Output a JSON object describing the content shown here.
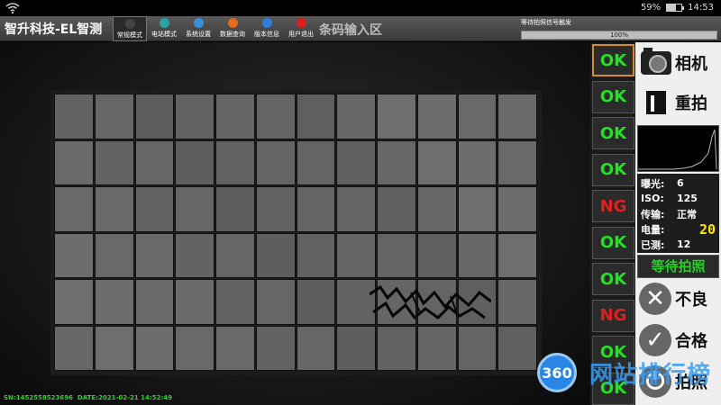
{
  "statusbar": {
    "battery": "59%",
    "battery_level": 0.59,
    "time": "14:53"
  },
  "header": {
    "title": "智升科技-EL智测",
    "toolbar": [
      {
        "label": "常规模式",
        "icon": "camera-mode-icon",
        "color": "#444444",
        "active": true
      },
      {
        "label": "电站模式",
        "icon": "station-mode-icon",
        "color": "#2aa3a3",
        "active": false
      },
      {
        "label": "系统设置",
        "icon": "gear-icon",
        "color": "#3a8fd8",
        "active": false
      },
      {
        "label": "数据查询",
        "icon": "chart-icon",
        "color": "#e36a1f",
        "active": false
      },
      {
        "label": "版本信息",
        "icon": "info-person-icon",
        "color": "#2f7ed8",
        "active": false
      },
      {
        "label": "用户退出",
        "icon": "power-icon",
        "color": "#d82020",
        "active": false
      }
    ],
    "barcode_label": "条码输入区",
    "trigger_status": "等待拍照信号触发",
    "progress": {
      "value": 1.0,
      "text": "100%"
    }
  },
  "viewer": {
    "serial": "SN:1452558523696",
    "date": "DATE:2021-02-21 14:52:49"
  },
  "results": [
    {
      "text": "OK",
      "status": "ok"
    },
    {
      "text": "OK",
      "status": "ok"
    },
    {
      "text": "OK",
      "status": "ok"
    },
    {
      "text": "OK",
      "status": "ok"
    },
    {
      "text": "NG",
      "status": "ng"
    },
    {
      "text": "OK",
      "status": "ok"
    },
    {
      "text": "OK",
      "status": "ok"
    },
    {
      "text": "NG",
      "status": "ng"
    },
    {
      "text": "OK",
      "status": "ok"
    },
    {
      "text": "OK",
      "status": "ok"
    }
  ],
  "side": {
    "camera_label": "相机",
    "retake_label": "重拍",
    "info": [
      {
        "key": "曝光:",
        "value": "6"
      },
      {
        "key": "ISO:",
        "value": "125"
      },
      {
        "key": "传输:",
        "value": "正常"
      },
      {
        "key": "电量:",
        "value": "20"
      },
      {
        "key": "已测:",
        "value": "12"
      }
    ],
    "wait_text": "等待拍照",
    "reject_label": "不良",
    "pass_label": "合格",
    "shoot_label": "拍照"
  },
  "watermark": {
    "logo": "360",
    "text": "网站排行榜"
  }
}
